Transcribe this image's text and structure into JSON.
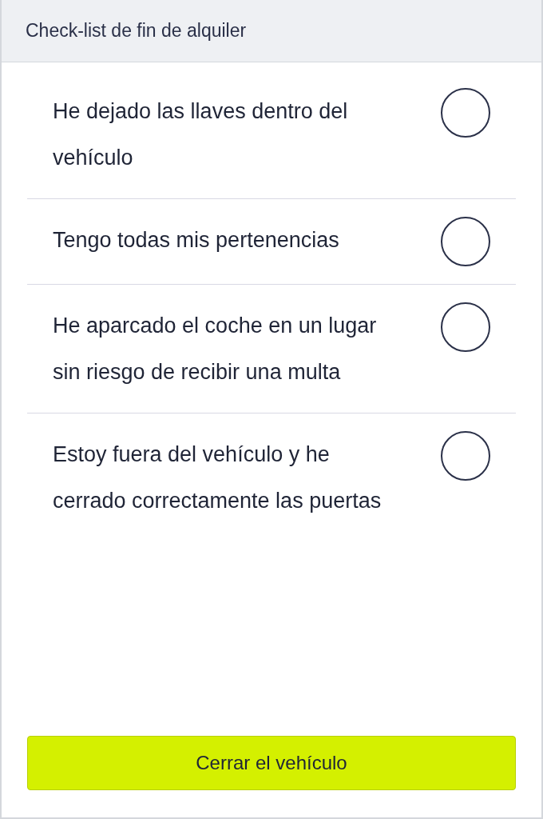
{
  "header": {
    "title": "Check-list de fin de alquiler"
  },
  "items": [
    {
      "label": "He dejado las llaves dentro del vehículo",
      "checked": false
    },
    {
      "label": "Tengo todas mis pertenencias",
      "checked": false
    },
    {
      "label": "He aparcado el coche en un lugar sin riesgo de recibir una multa",
      "checked": false
    },
    {
      "label": "Estoy fuera del vehículo y he cerrado correctamente las puertas",
      "checked": false
    }
  ],
  "button": {
    "label": "Cerrar el vehículo"
  }
}
